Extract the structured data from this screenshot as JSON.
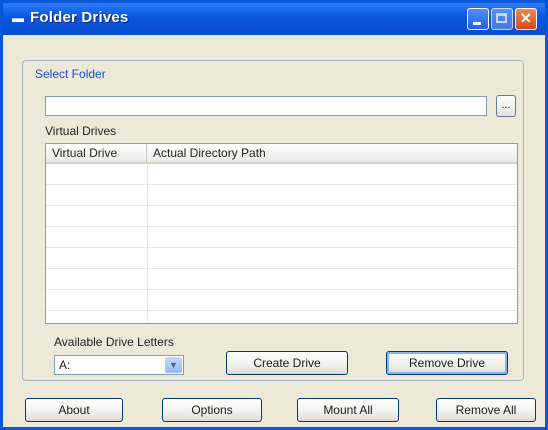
{
  "window": {
    "title": "Folder Drives",
    "icon": "folder-drive-icon",
    "controls": [
      "minimize-icon",
      "maximize-icon",
      "close-icon"
    ]
  },
  "select_folder": {
    "group_label": "Select Folder",
    "path_value": "",
    "browse_label": "..."
  },
  "virtual_drives": {
    "label": "Virtual Drives",
    "columns": [
      "Virtual Drive",
      "Actual Directory Path"
    ],
    "rows": []
  },
  "drive_letters": {
    "label": "Available Drive Letters",
    "selected": "A:"
  },
  "actions": {
    "create_drive": "Create Drive",
    "remove_drive": "Remove Drive"
  },
  "footer": {
    "about": "About",
    "options": "Options",
    "mount_all": "Mount All",
    "remove_all": "Remove All"
  },
  "colors": {
    "titlebar": "#0b55de",
    "group_label": "#1b4cd1",
    "window_bg": "#ece9d8"
  }
}
